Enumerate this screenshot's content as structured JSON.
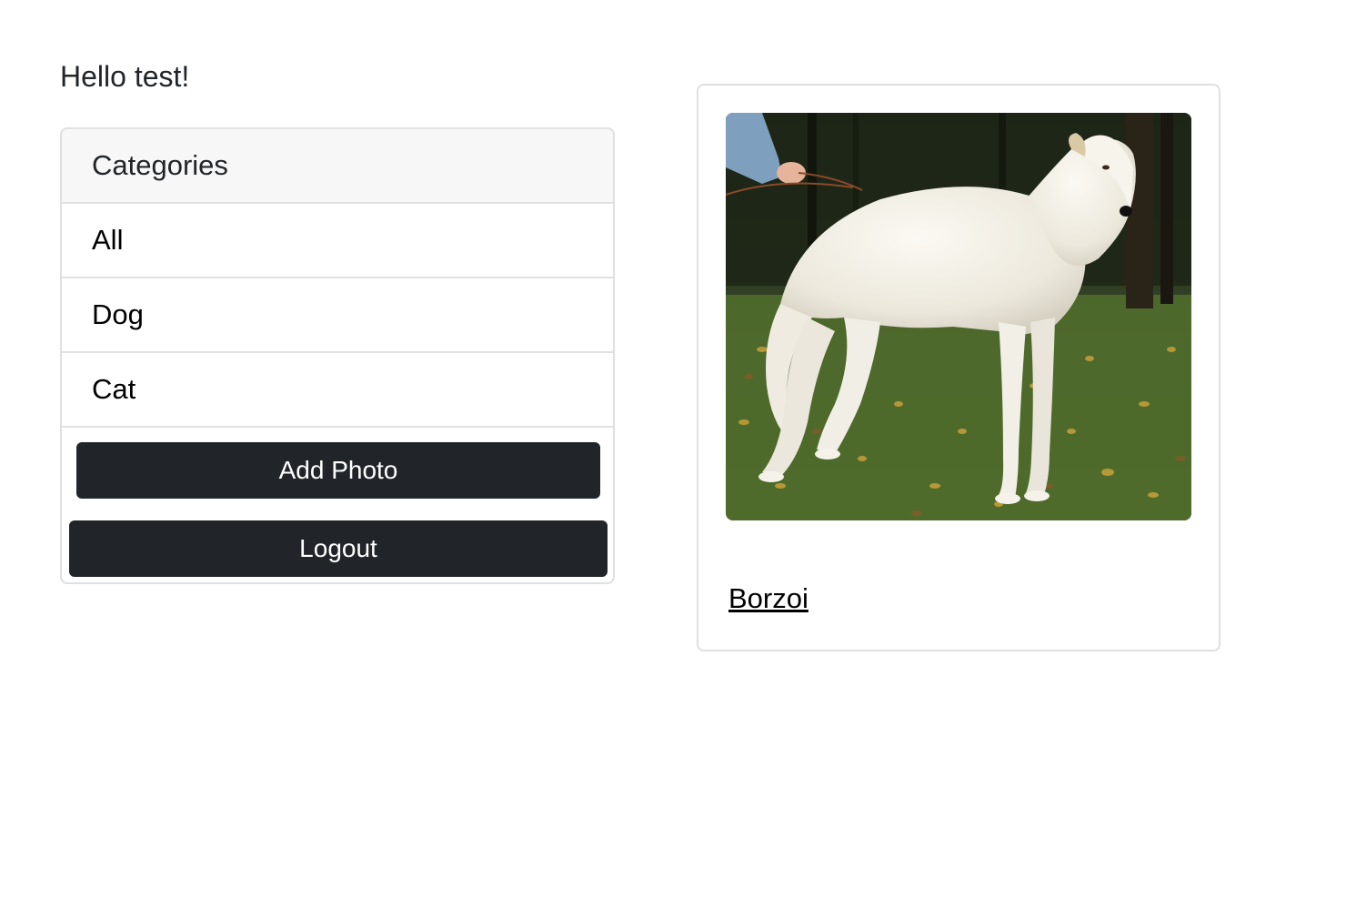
{
  "greeting": "Hello test!",
  "categories": {
    "header": "Categories",
    "items": [
      {
        "label": "All"
      },
      {
        "label": "Dog"
      },
      {
        "label": "Cat"
      }
    ],
    "add_photo_label": "Add Photo",
    "logout_label": "Logout"
  },
  "photos": [
    {
      "title": "Borzoi",
      "image": "white-borzoi-dog-on-autumn-grass"
    }
  ],
  "colors": {
    "button_bg": "#212529",
    "header_bg": "#f7f7f7",
    "border": "#dfe0e2"
  }
}
